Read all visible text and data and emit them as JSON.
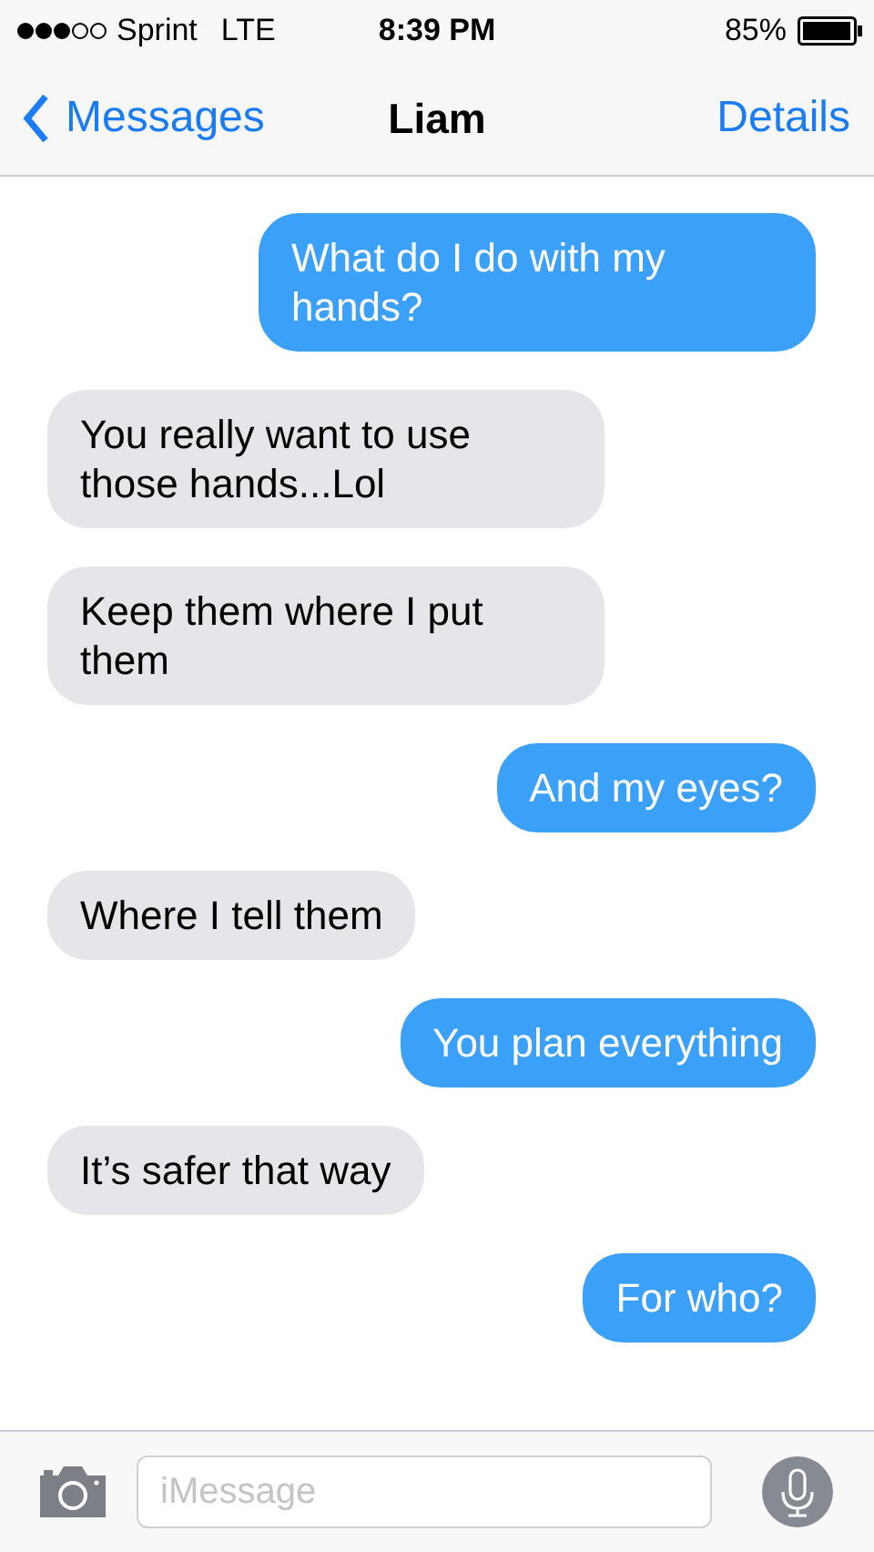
{
  "status_bar": {
    "carrier": "Sprint",
    "network": "LTE",
    "time": "8:39 PM",
    "battery": "85%"
  },
  "nav": {
    "back": "Messages",
    "title": "Liam",
    "action": "Details"
  },
  "messages": [
    {
      "kind": "sent",
      "text": "What do I do with my hands?"
    },
    {
      "kind": "received",
      "text": "You really want to use those hands...Lol"
    },
    {
      "kind": "received",
      "text": "Keep them where I put them"
    },
    {
      "kind": "sent",
      "text": "And my eyes?"
    },
    {
      "kind": "received",
      "text": "Where I tell them"
    },
    {
      "kind": "sent",
      "text": "You plan everything"
    },
    {
      "kind": "received",
      "text": "It’s safer that way"
    },
    {
      "kind": "sent",
      "text": "For who?"
    }
  ],
  "composer": {
    "placeholder": "iMessage"
  }
}
